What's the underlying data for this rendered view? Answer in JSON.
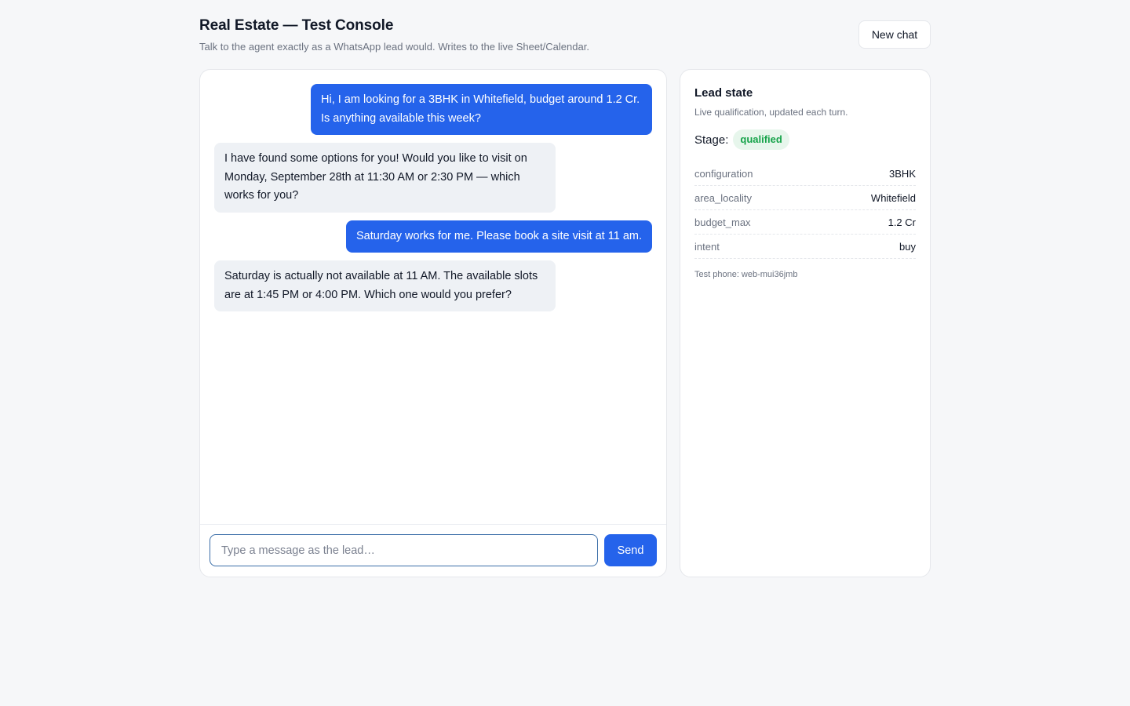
{
  "header": {
    "title": "Real Estate — Test Console",
    "subtitle": "Talk to the agent exactly as a WhatsApp lead would. Writes to the live Sheet/Calendar.",
    "new_chat_label": "New chat"
  },
  "chat": {
    "messages": [
      {
        "direction": "out",
        "text": "Hi, I am looking for a 3BHK in Whitefield, budget around 1.2 Cr. Is anything available this week?"
      },
      {
        "direction": "in",
        "text": "I have found some options for you! Would you like to visit on Monday, September 28th at 11:30 AM or 2:30 PM — which works for you?"
      },
      {
        "direction": "out",
        "text": "Saturday works for me. Please book a site visit at 11 am."
      },
      {
        "direction": "in",
        "text": "Saturday is actually not available at 11 AM. The available slots are at 1:45 PM or 4:00 PM. Which one would you prefer?"
      }
    ],
    "input_placeholder": "Type a message as the lead…",
    "input_value": "",
    "send_label": "Send"
  },
  "lead": {
    "title": "Lead state",
    "subtitle": "Live qualification, updated each turn.",
    "stage_label": "Stage:",
    "stage_value": "qualified",
    "fields": [
      {
        "key": "configuration",
        "value": "3BHK"
      },
      {
        "key": "area_locality",
        "value": "Whitefield"
      },
      {
        "key": "budget_max",
        "value": "1.2 Cr"
      },
      {
        "key": "intent",
        "value": "buy"
      }
    ],
    "test_phone": "Test phone: web-mui36jmb"
  },
  "colors": {
    "accent": "#2563eb",
    "badge_bg": "#e7f6ec",
    "badge_text": "#16a34a"
  }
}
